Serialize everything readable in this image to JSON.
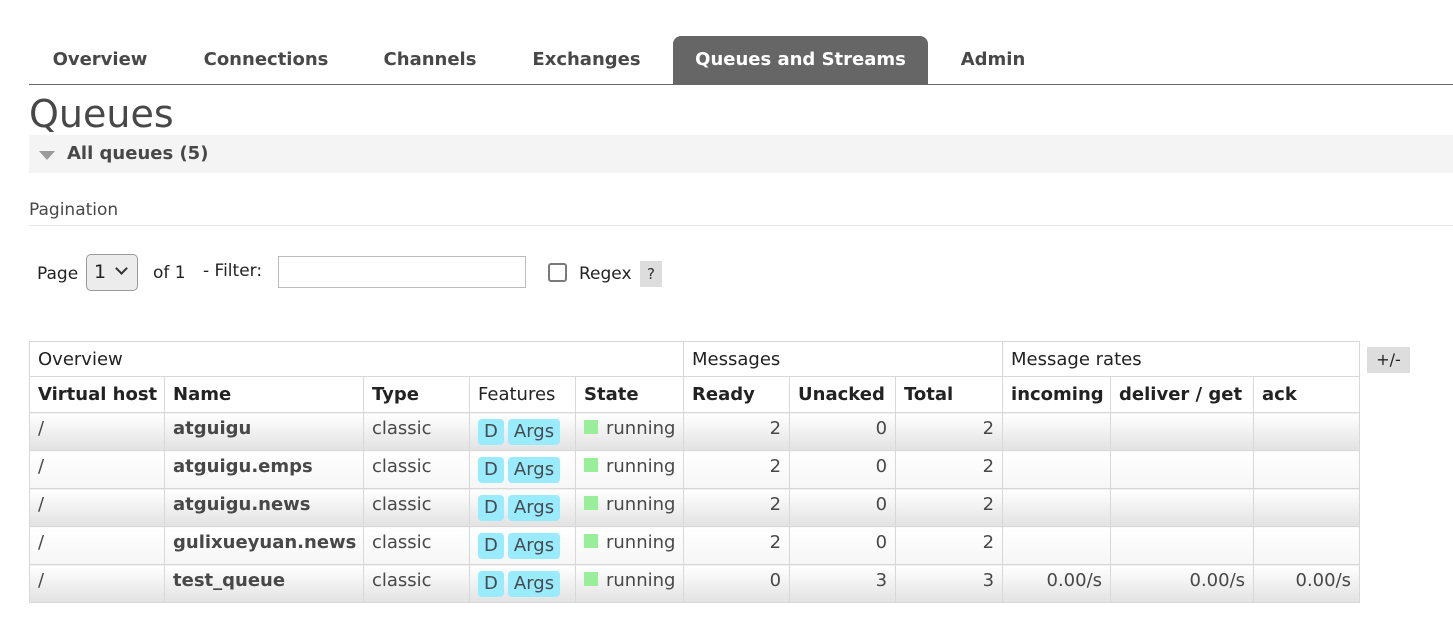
{
  "nav": {
    "tabs": [
      {
        "label": "Overview",
        "active": false
      },
      {
        "label": "Connections",
        "active": false
      },
      {
        "label": "Channels",
        "active": false
      },
      {
        "label": "Exchanges",
        "active": false
      },
      {
        "label": "Queues and Streams",
        "active": true
      },
      {
        "label": "Admin",
        "active": false
      }
    ]
  },
  "page": {
    "title": "Queues",
    "section_label": "All queues (5)"
  },
  "pagination": {
    "title": "Pagination",
    "page_label": "Page",
    "page_value": "1",
    "of_label": "of 1",
    "filter_label": "- Filter:",
    "filter_value": "",
    "regex_label": "Regex",
    "regex_checked": false,
    "help_label": "?"
  },
  "table": {
    "groups": {
      "overview": "Overview",
      "messages": "Messages",
      "rates": "Message rates"
    },
    "columns": [
      "Virtual host",
      "Name",
      "Type",
      "Features",
      "State",
      "Ready",
      "Unacked",
      "Total",
      "incoming",
      "deliver / get",
      "ack"
    ],
    "toggle_label": "+/-",
    "rows": [
      {
        "vhost": "/",
        "name": "atguigu",
        "type": "classic",
        "feat_d": "D",
        "feat_args": "Args",
        "state": "running",
        "ready": "2",
        "unacked": "0",
        "total": "2",
        "incoming": "",
        "deliver": "",
        "ack": ""
      },
      {
        "vhost": "/",
        "name": "atguigu.emps",
        "type": "classic",
        "feat_d": "D",
        "feat_args": "Args",
        "state": "running",
        "ready": "2",
        "unacked": "0",
        "total": "2",
        "incoming": "",
        "deliver": "",
        "ack": ""
      },
      {
        "vhost": "/",
        "name": "atguigu.news",
        "type": "classic",
        "feat_d": "D",
        "feat_args": "Args",
        "state": "running",
        "ready": "2",
        "unacked": "0",
        "total": "2",
        "incoming": "",
        "deliver": "",
        "ack": ""
      },
      {
        "vhost": "/",
        "name": "gulixueyuan.news",
        "type": "classic",
        "feat_d": "D",
        "feat_args": "Args",
        "state": "running",
        "ready": "2",
        "unacked": "0",
        "total": "2",
        "incoming": "",
        "deliver": "",
        "ack": ""
      },
      {
        "vhost": "/",
        "name": "test_queue",
        "type": "classic",
        "feat_d": "D",
        "feat_args": "Args",
        "state": "running",
        "ready": "0",
        "unacked": "3",
        "total": "3",
        "incoming": "0.00/s",
        "deliver": "0.00/s",
        "ack": "0.00/s"
      }
    ]
  },
  "colors": {
    "active_tab": "#666666",
    "feature_badge": "#99ebff",
    "state_running": "#99ee99"
  },
  "icons": {
    "collapse": "triangle-down-icon",
    "select": "chevron-down-icon"
  }
}
